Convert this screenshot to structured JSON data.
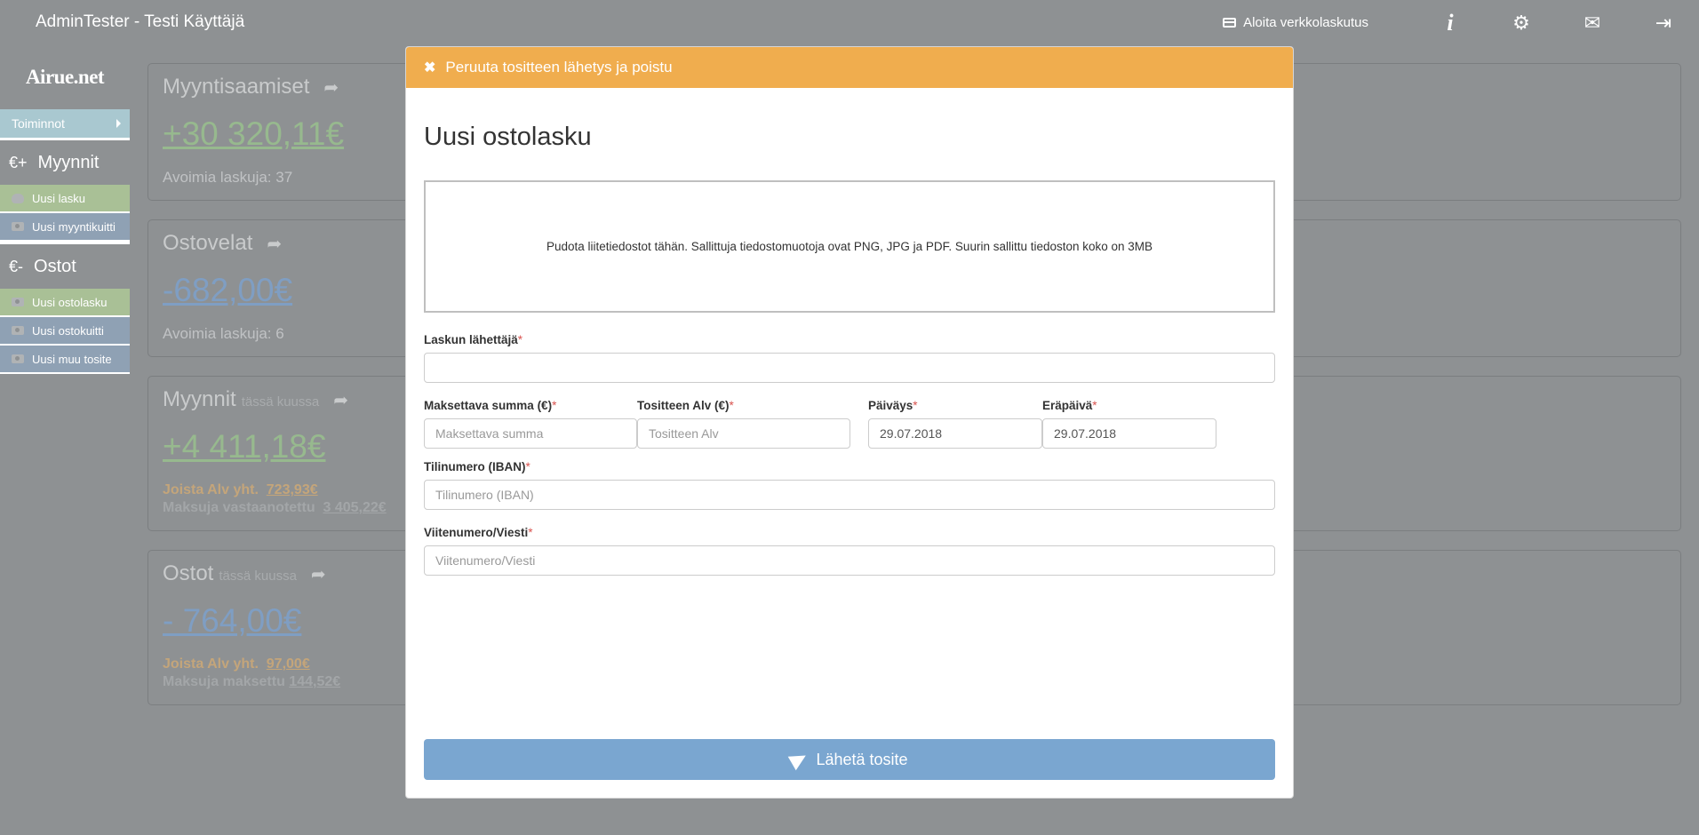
{
  "topbar": {
    "title": "AdminTester - Testi Käyttäjä",
    "online_invoicing": "Aloita verkkolaskutus",
    "icons": [
      "info-icon",
      "gear-icon",
      "mail-icon",
      "logout-icon"
    ]
  },
  "sidebar": {
    "logo": "Airue.net",
    "toiminnot": "Toiminnot",
    "sales_symbol": "€+",
    "sales_title": "Myynnit",
    "sales_items": [
      "Uusi lasku",
      "Uusi myyntikuitti"
    ],
    "purchases_symbol": "€-",
    "purchases_title": "Ostot",
    "purchase_items": [
      "Uusi ostolasku",
      "Uusi ostokuitti",
      "Uusi muu tosite"
    ]
  },
  "cards": {
    "receivables": {
      "title": "Myyntisaamiset",
      "value": "+30 320,11€",
      "sub": "Avoimia laskuja: 37"
    },
    "payables": {
      "title": "Ostovelat",
      "value": "-682,00€",
      "sub": "Avoimia laskuja: 6"
    },
    "sales_month": {
      "title": "Myynnit",
      "title_small": "tässä kuussa",
      "value": "+4 411,18€",
      "vat_label": "Joista Alv yht.",
      "vat_value": "723,93€",
      "payments_label": "Maksuja vastaanotettu",
      "payments_value": "3 405,22€"
    },
    "purchases_month": {
      "title": "Ostot",
      "title_small": "tässä kuussa",
      "value": "- 764,00€",
      "vat_label": "Joista Alv yht.",
      "vat_value": "97,00€",
      "payments_label": "Maksuja maksettu",
      "payments_value": "144,52€"
    }
  },
  "modal": {
    "cancel_label": "Peruuta tositteen lähetys ja poistu",
    "title": "Uusi ostolasku",
    "dropzone_text": "Pudota liitetiedostot tähän. Sallittuja tiedostomuotoja ovat PNG, JPG ja PDF. Suurin sallittu tiedoston koko on 3MB",
    "sender_label": "Laskun lähettäjä",
    "sender_value": "",
    "amount_label": "Maksettava summa (€)",
    "amount_placeholder": "Maksettava summa",
    "vat_label": "Tositteen Alv (€)",
    "vat_placeholder": "Tositteen Alv",
    "date_label": "Päiväys",
    "date_value": "29.07.2018",
    "due_label": "Eräpäivä",
    "due_value": "29.07.2018",
    "iban_label": "Tilinumero (IBAN)",
    "iban_placeholder": "Tilinumero (IBAN)",
    "ref_label": "Viitenumero/Viesti",
    "ref_placeholder": "Viitenumero/Viesti",
    "required_mark": "*",
    "submit_label": "Lähetä tosite"
  },
  "colors": {
    "header_orange": "#f0ad4e",
    "submit_blue": "#7aa6d0",
    "overlay_gray": "#8e9193"
  }
}
